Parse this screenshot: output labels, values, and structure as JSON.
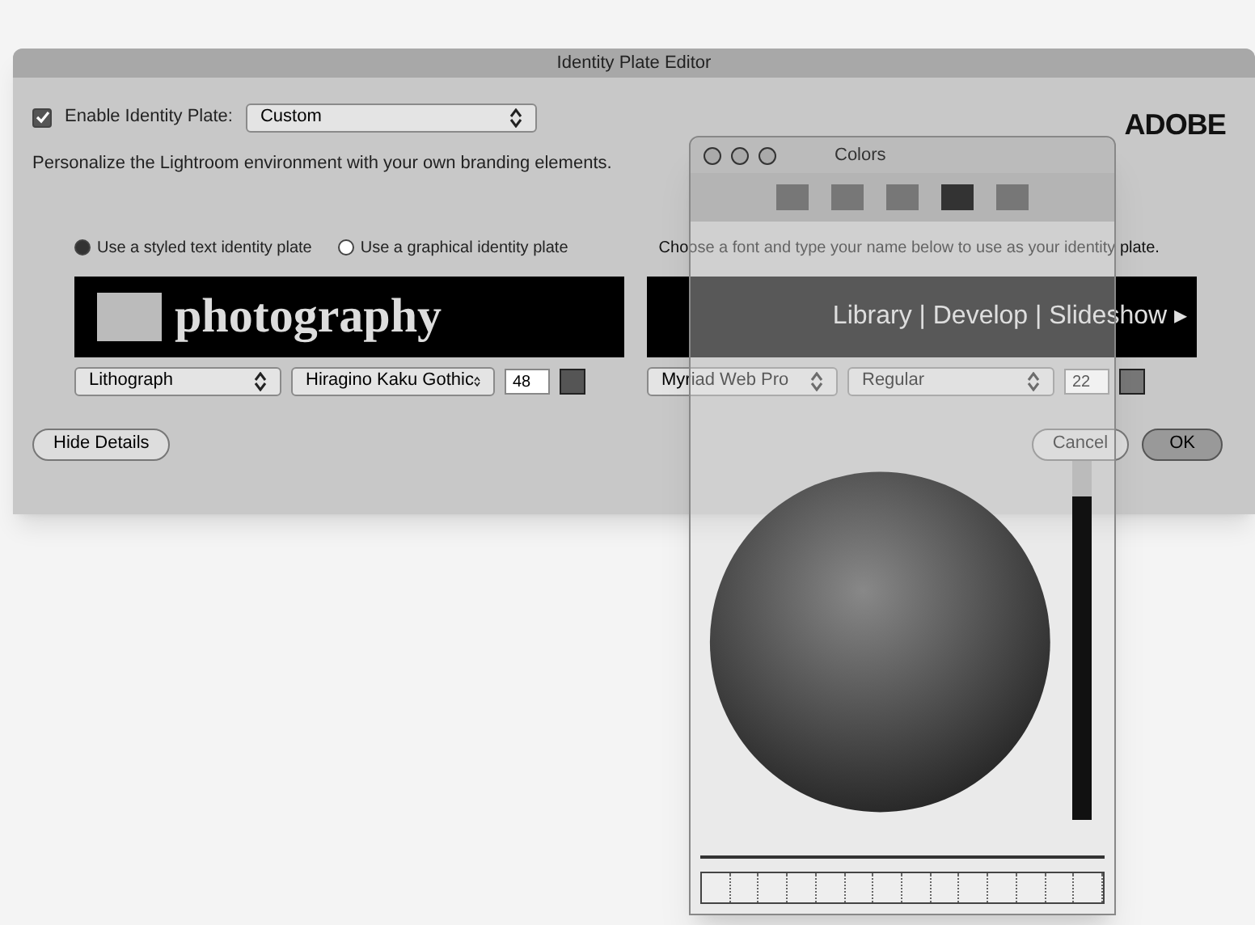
{
  "dialog": {
    "title": "Identity Plate Editor",
    "enable": {
      "label": "Enable Identity Plate:",
      "checked": true
    },
    "preset": "Custom",
    "logo": "ADOBE",
    "description": "Personalize the Lightroom environment with your own branding elements.",
    "plate_options": [
      {
        "label": "Use a styled text identity plate",
        "selected": true
      },
      {
        "label": "Use a graphical identity plate",
        "selected": false
      }
    ],
    "hint": "Choose a font and type your name below to use as your identity plate.",
    "plate_text": "photography",
    "module_text": "Library | Develop | Slideshow ▸",
    "left_font": {
      "family": "Lithograph",
      "style": "Hiragino Kaku Gothic",
      "size": "48"
    },
    "right_font": {
      "family": "Myriad Web Pro",
      "style": "Regular",
      "size": "22"
    },
    "buttons": {
      "details": "Hide Details",
      "cancel": "Cancel",
      "ok": "OK"
    }
  },
  "colors_window": {
    "title": "Colors",
    "brightness": {
      "level": 0.9
    }
  }
}
